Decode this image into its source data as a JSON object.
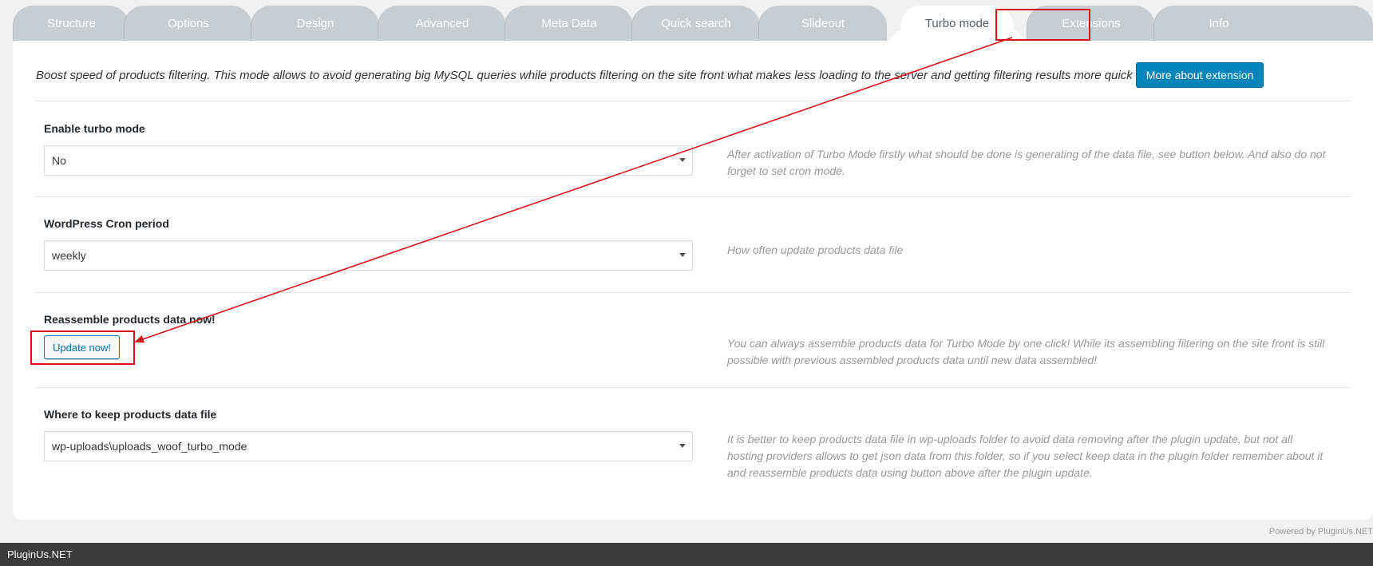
{
  "tabs": [
    {
      "label": "Structure",
      "active": false
    },
    {
      "label": "Options",
      "active": false
    },
    {
      "label": "Design",
      "active": false
    },
    {
      "label": "Advanced",
      "active": false
    },
    {
      "label": "Meta Data",
      "active": false
    },
    {
      "label": "Quick search",
      "active": false
    },
    {
      "label": "Slideout",
      "active": false
    },
    {
      "label": "Turbo mode",
      "active": true
    },
    {
      "label": "Extensions",
      "active": false
    },
    {
      "label": "Info",
      "active": false
    }
  ],
  "intro": {
    "text": "Boost speed of products filtering. This mode allows to avoid generating big MySQL queries while products filtering on the site front what makes less loading to the server and getting filtering results more quick",
    "button_label": "More about extension"
  },
  "sections": {
    "enable_turbo": {
      "label": "Enable turbo mode",
      "value": "No",
      "help": "After activation of Turbo Mode firstly what should be done is generating of the data file, see button below. And also do not forget to set cron mode."
    },
    "cron_period": {
      "label": "WordPress Cron period",
      "value": "weekly",
      "help": "How often update products data file"
    },
    "reassemble": {
      "label": "Reassemble products data now!",
      "button_label": "Update now!",
      "help": "You can always assemble products data for Turbo Mode by one click! While its assembling filtering on the site front is still possible with previous assembled products data until new data assembled!"
    },
    "data_location": {
      "label": "Where to keep products data file",
      "value": "wp-uploads\\uploads_woof_turbo_mode",
      "help": "It is better to keep products data file in wp-uploads folder to avoid data removing after the plugin update, but not all hosting providers allows to get json data from this folder, so if you select keep data in the plugin folder remember about it and reassemble products data using button above after the plugin update."
    }
  },
  "footer": {
    "powered_by": "Powered by PluginUs.NET",
    "bottom_bar": "PluginUs.NET"
  },
  "colors": {
    "tab_inactive": "#c8cdd2",
    "primary_button": "#0085ba",
    "annotation_red": "#d9141b",
    "help_text": "#999999"
  },
  "icons": {
    "select_caret": "chevron-down-icon"
  }
}
